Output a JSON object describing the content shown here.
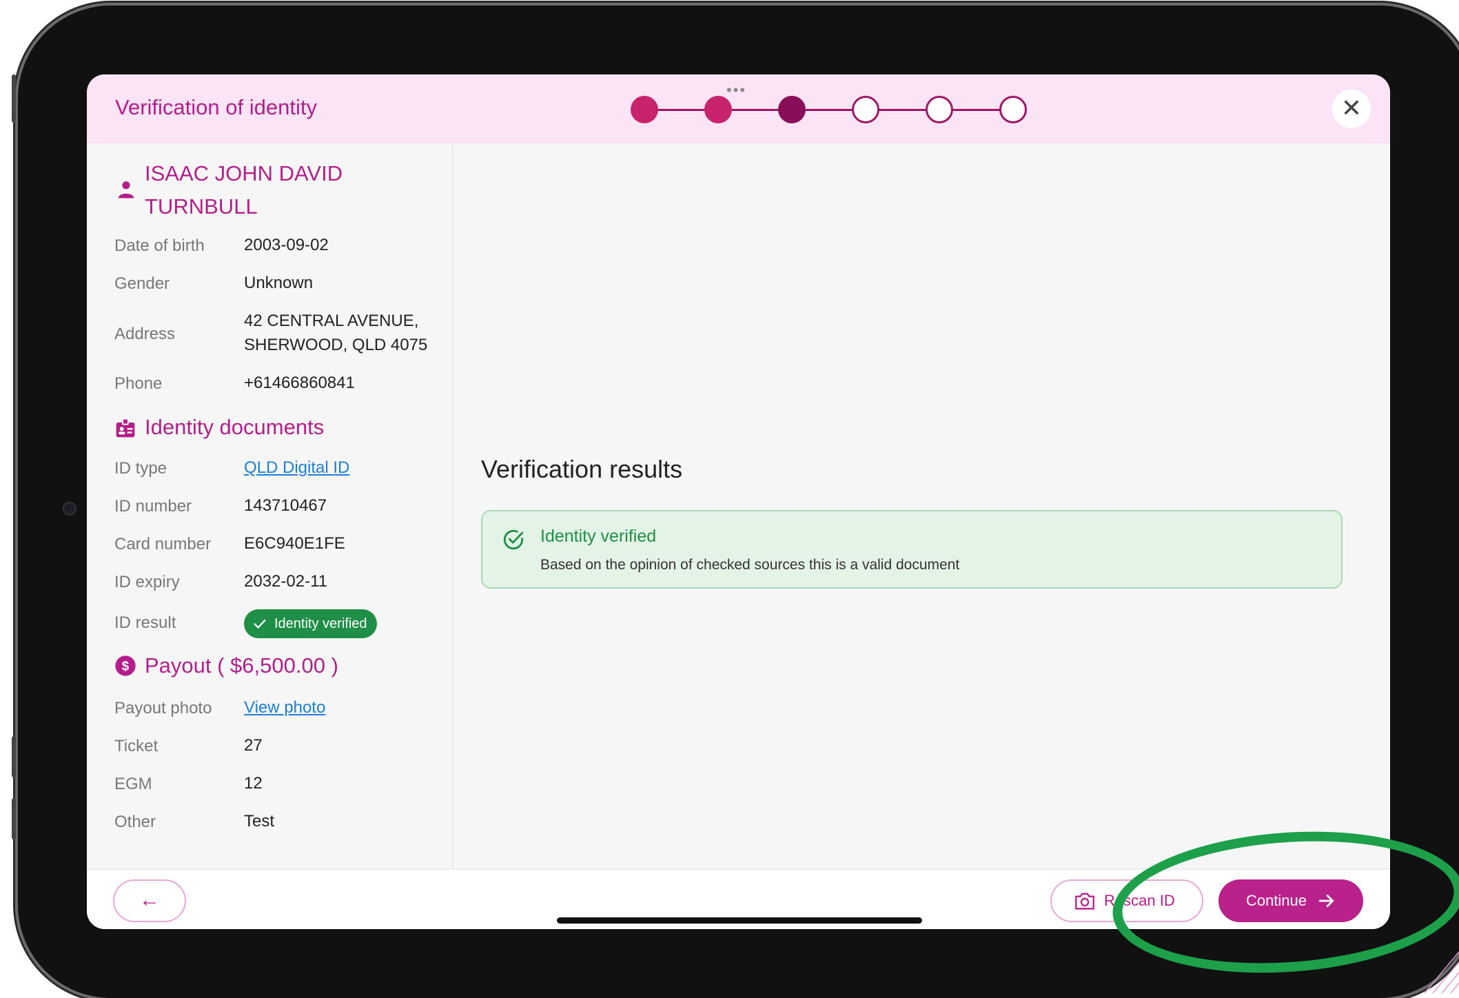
{
  "header": {
    "title": "Verification of identity",
    "more_dots": "•••",
    "steps": [
      "done",
      "done",
      "active",
      "todo",
      "todo",
      "todo"
    ],
    "close_label": "✕"
  },
  "person": {
    "name": "ISAAC JOHN DAVID TURNBULL",
    "fields": [
      {
        "label": "Date of birth",
        "value": "2003-09-02"
      },
      {
        "label": "Gender",
        "value": "Unknown"
      },
      {
        "label": "Address",
        "value": "42 CENTRAL AVENUE, SHERWOOD, QLD 4075"
      },
      {
        "label": "Phone",
        "value": "+61466860841"
      }
    ]
  },
  "identity_documents": {
    "title": "Identity documents",
    "fields": [
      {
        "label": "ID type",
        "value": "QLD Digital ID"
      },
      {
        "label": "ID number",
        "value": "143710467"
      },
      {
        "label": "Card number",
        "value": "E6C940E1FE"
      },
      {
        "label": "ID expiry",
        "value": "2032-02-11"
      },
      {
        "label": "ID result",
        "value": "Identity verified"
      }
    ]
  },
  "payout": {
    "title": "Payout ( $6,500.00 )",
    "fields": [
      {
        "label": "Payout photo",
        "value": "View photo"
      },
      {
        "label": "Ticket",
        "value": "27"
      },
      {
        "label": "EGM",
        "value": "12"
      },
      {
        "label": "Other",
        "value": "Test"
      }
    ]
  },
  "results": {
    "title": "Verification results",
    "status_title": "Identity verified",
    "status_text": "Based on the opinion of checked sources this is a valid document"
  },
  "footer": {
    "back_label": "←",
    "rescan_label": "Rescan ID",
    "continue_label": "Continue"
  },
  "colors": {
    "brand": "#b31e8c",
    "success": "#1f8f48",
    "annotation": "#1ea04a"
  }
}
